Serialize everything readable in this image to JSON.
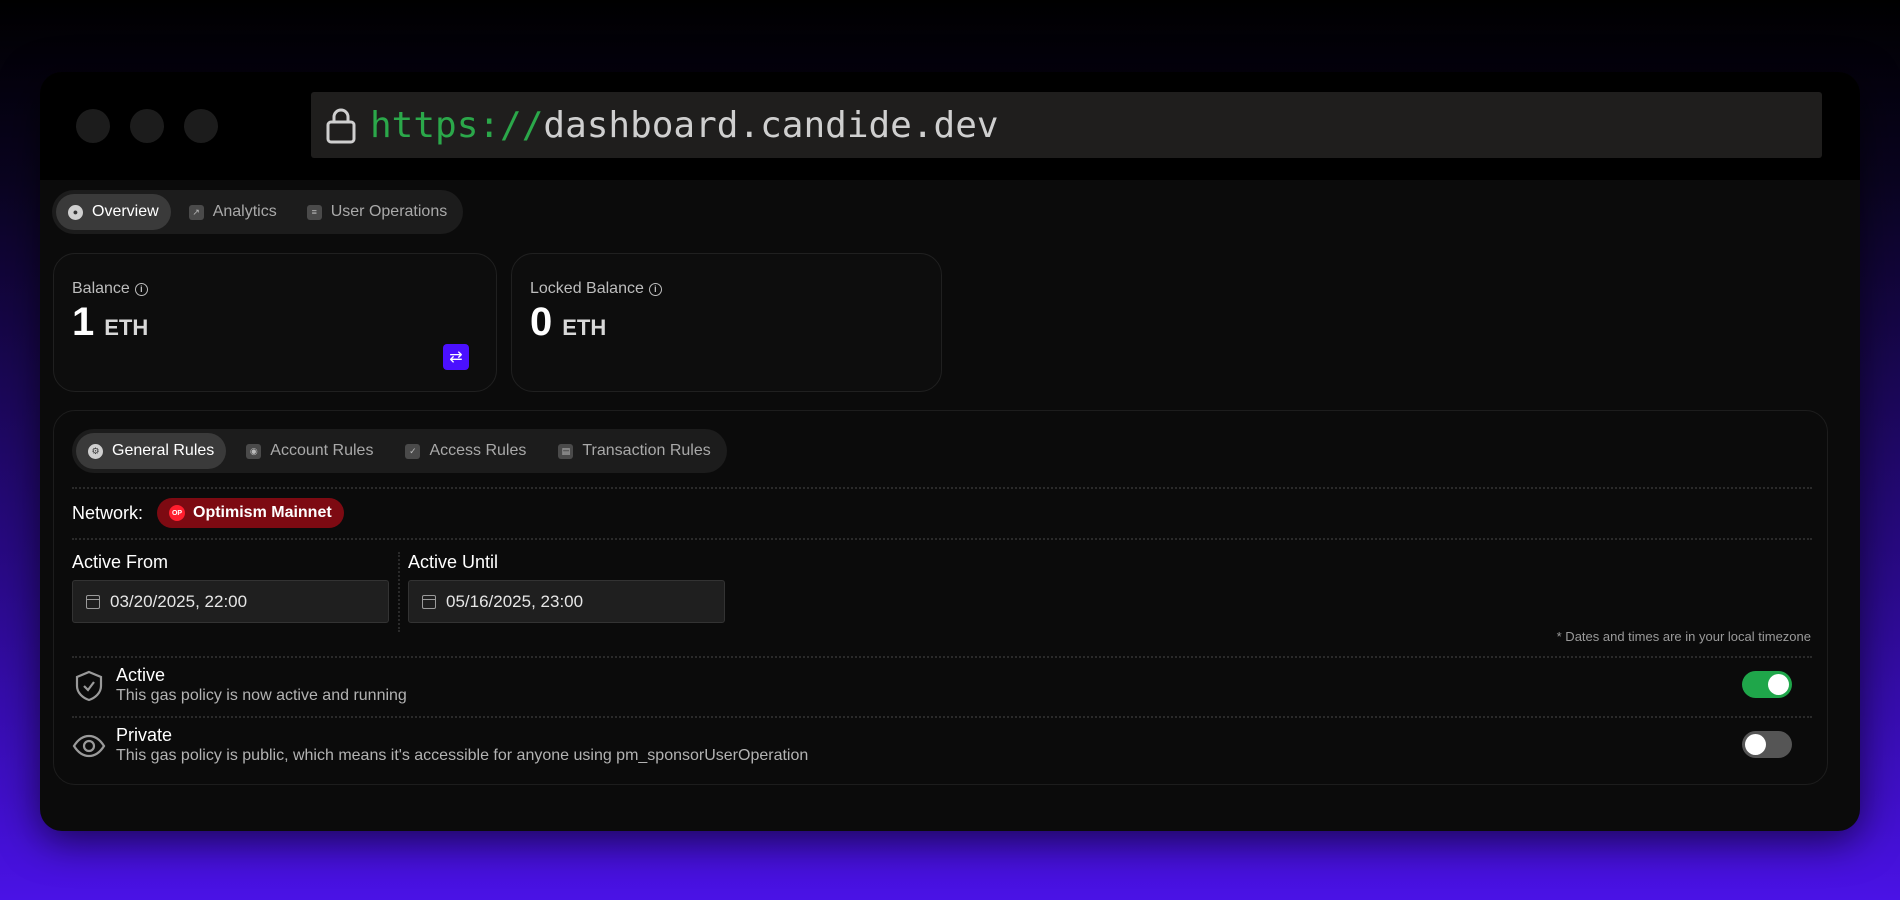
{
  "browser": {
    "url_scheme": "https://",
    "url_host": "dashboard.candide.dev"
  },
  "top_tabs": [
    {
      "label": "Overview",
      "icon": "overview-icon",
      "active": true
    },
    {
      "label": "Analytics",
      "icon": "analytics-icon",
      "active": false
    },
    {
      "label": "User Operations",
      "icon": "list-icon",
      "active": false
    }
  ],
  "balance": {
    "label": "Balance",
    "value": "1",
    "unit": "ETH"
  },
  "locked_balance": {
    "label": "Locked Balance",
    "value": "0",
    "unit": "ETH"
  },
  "rule_tabs": [
    {
      "label": "General Rules",
      "icon": "settings-icon",
      "active": true
    },
    {
      "label": "Account Rules",
      "icon": "user-icon",
      "active": false
    },
    {
      "label": "Access Rules",
      "icon": "shield-icon",
      "active": false
    },
    {
      "label": "Transaction Rules",
      "icon": "transaction-icon",
      "active": false
    }
  ],
  "network": {
    "label": "Network:",
    "value": "Optimism Mainnet",
    "badge": "OP"
  },
  "active_from": {
    "label": "Active From",
    "value": "03/20/2025, 22:00"
  },
  "active_until": {
    "label": "Active Until",
    "value": "05/16/2025, 23:00"
  },
  "timezone_note": "* Dates and times are in your local timezone",
  "active_row": {
    "title": "Active",
    "description": "This gas policy is now active and running",
    "enabled": true
  },
  "private_row": {
    "title": "Private",
    "description": "This gas policy is public, which means it's accessible for anyone using pm_sponsorUserOperation",
    "enabled": false
  },
  "colors": {
    "accent": "#4b10ff",
    "toggle_on": "#1fa64a",
    "network_badge": "#7d0a12",
    "url_scheme": "#2ba84a"
  }
}
